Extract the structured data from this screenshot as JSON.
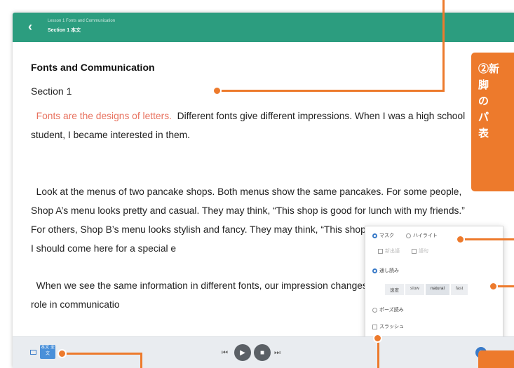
{
  "header": {
    "back_label": "‹",
    "crumb_line1": "Lesson 1 Fonts and Communication",
    "crumb_line2": "Section 1 本文"
  },
  "main": {
    "title": "Fonts and Communication",
    "section": "Section 1",
    "p1_highlight": "Fonts are the designs of letters.",
    "p1_rest": "Different fonts give different impressions. When I was a high school student, I became interested in them.",
    "p2": "Look at the menus of two pancake shops. Both menus show the same pancakes. For some people, Shop A’s menu looks pretty and casual. They may think, “This shop is good for lunch with my friends.” For others, Shop B’s menu looks stylish and fancy. They may think, “This shop has expensive pancakes. I should come here for a special e",
    "p3": "When we see the same information in different fonts, our impression changes. Fonts play an important role in communicatio"
  },
  "popup": {
    "mask_label": "マスク",
    "highlight_label": "ハイライト",
    "new_words_label": "新出語",
    "words_label": "語句",
    "read_through_label": "通し読み",
    "speed_label": "速度",
    "speed_options": [
      "slow",
      "natural",
      "fast"
    ],
    "pause_read_label": "ポーズ読み",
    "slash_label": "スラッシュ"
  },
  "bottombar": {
    "prev_label": "⏮",
    "play_label": "▶",
    "stop_label": "■",
    "next_label": "⏭",
    "view_button_label": "本文 全文"
  },
  "callout": {
    "lines": [
      "②新",
      "脚",
      "の",
      "パ",
      "表"
    ]
  },
  "colors": {
    "header": "#2c9d7f",
    "accent_orange": "#ed7a2c",
    "highlight_text": "#e8725f",
    "selected_radio": "#3a7bc8"
  }
}
